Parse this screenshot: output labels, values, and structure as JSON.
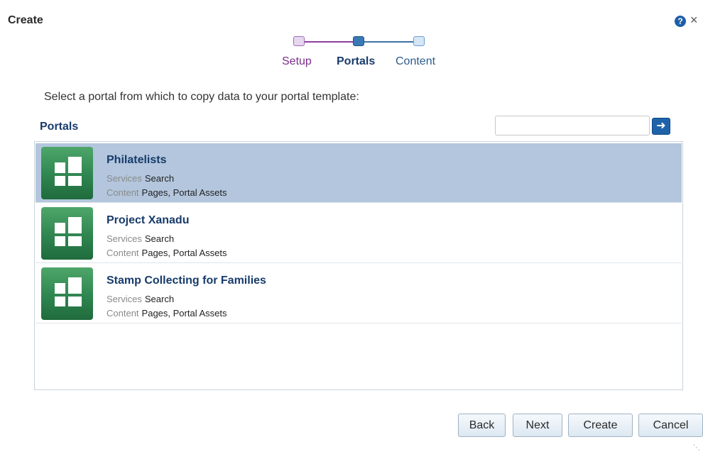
{
  "dialog": {
    "title": "Create"
  },
  "train": {
    "steps": [
      "Setup",
      "Portals",
      "Content"
    ],
    "current": "Portals"
  },
  "instruction": "Select a portal from which to copy data to your portal template:",
  "section": {
    "label": "Portals"
  },
  "search": {
    "value": "",
    "placeholder": "",
    "go_icon": "arrow-right-icon"
  },
  "portals": [
    {
      "name": "Philatelists",
      "services_key": "Services",
      "services": "Search",
      "content_key": "Content",
      "content": "Pages, Portal Assets",
      "selected": true
    },
    {
      "name": "Project Xanadu",
      "services_key": "Services",
      "services": "Search",
      "content_key": "Content",
      "content": "Pages, Portal Assets",
      "selected": false
    },
    {
      "name": "Stamp Collecting for Families",
      "services_key": "Services",
      "services": "Search",
      "content_key": "Content",
      "content": "Pages, Portal Assets",
      "selected": false
    }
  ],
  "buttons": {
    "back": "Back",
    "next": "Next",
    "create": "Create",
    "cancel": "Cancel"
  },
  "icons": {
    "help": "?",
    "close": "×"
  },
  "colors": {
    "selected_row": "#b3c6dd",
    "accent": "#173b6b",
    "portal_icon": "#2f8550"
  }
}
